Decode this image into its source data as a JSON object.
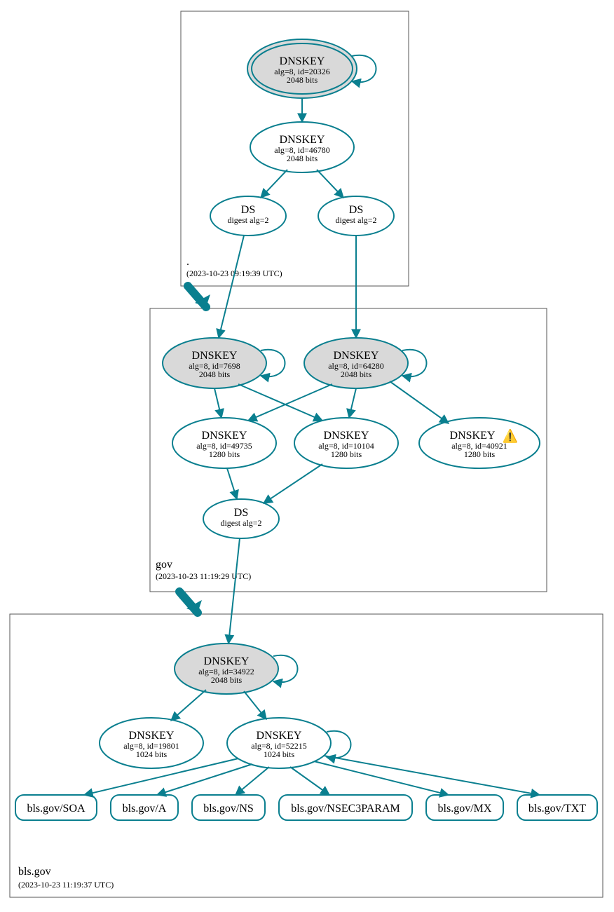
{
  "zones": {
    "root": {
      "label": ".",
      "time": "(2023-10-23 09:19:39 UTC)"
    },
    "gov": {
      "label": "gov",
      "time": "(2023-10-23 11:19:29 UTC)"
    },
    "bls": {
      "label": "bls.gov",
      "time": "(2023-10-23 11:19:37 UTC)"
    }
  },
  "nodes": {
    "root_ksk": {
      "title": "DNSKEY",
      "l1": "alg=8, id=20326",
      "l2": "2048 bits"
    },
    "root_zsk": {
      "title": "DNSKEY",
      "l1": "alg=8, id=46780",
      "l2": "2048 bits"
    },
    "root_ds1": {
      "title": "DS",
      "l1": "digest alg=2"
    },
    "root_ds2": {
      "title": "DS",
      "l1": "digest alg=2"
    },
    "gov_k1": {
      "title": "DNSKEY",
      "l1": "alg=8, id=7698",
      "l2": "2048 bits"
    },
    "gov_k2": {
      "title": "DNSKEY",
      "l1": "alg=8, id=64280",
      "l2": "2048 bits"
    },
    "gov_z1": {
      "title": "DNSKEY",
      "l1": "alg=8, id=49735",
      "l2": "1280 bits"
    },
    "gov_z2": {
      "title": "DNSKEY",
      "l1": "alg=8, id=10104",
      "l2": "1280 bits"
    },
    "gov_z3": {
      "title": "DNSKEY",
      "l1": "alg=8, id=40921",
      "l2": "1280 bits"
    },
    "gov_ds": {
      "title": "DS",
      "l1": "digest alg=2"
    },
    "bls_ksk": {
      "title": "DNSKEY",
      "l1": "alg=8, id=34922",
      "l2": "2048 bits"
    },
    "bls_z1": {
      "title": "DNSKEY",
      "l1": "alg=8, id=19801",
      "l2": "1024 bits"
    },
    "bls_z2": {
      "title": "DNSKEY",
      "l1": "alg=8, id=52215",
      "l2": "1024 bits"
    }
  },
  "rr": {
    "soa": "bls.gov/SOA",
    "a": "bls.gov/A",
    "ns": "bls.gov/NS",
    "nsec3": "bls.gov/NSEC3PARAM",
    "mx": "bls.gov/MX",
    "txt": "bls.gov/TXT"
  },
  "warn_icon": "⚠️",
  "colors": {
    "stroke": "#0a7f8f",
    "fill_grey": "#d9d9d9"
  }
}
